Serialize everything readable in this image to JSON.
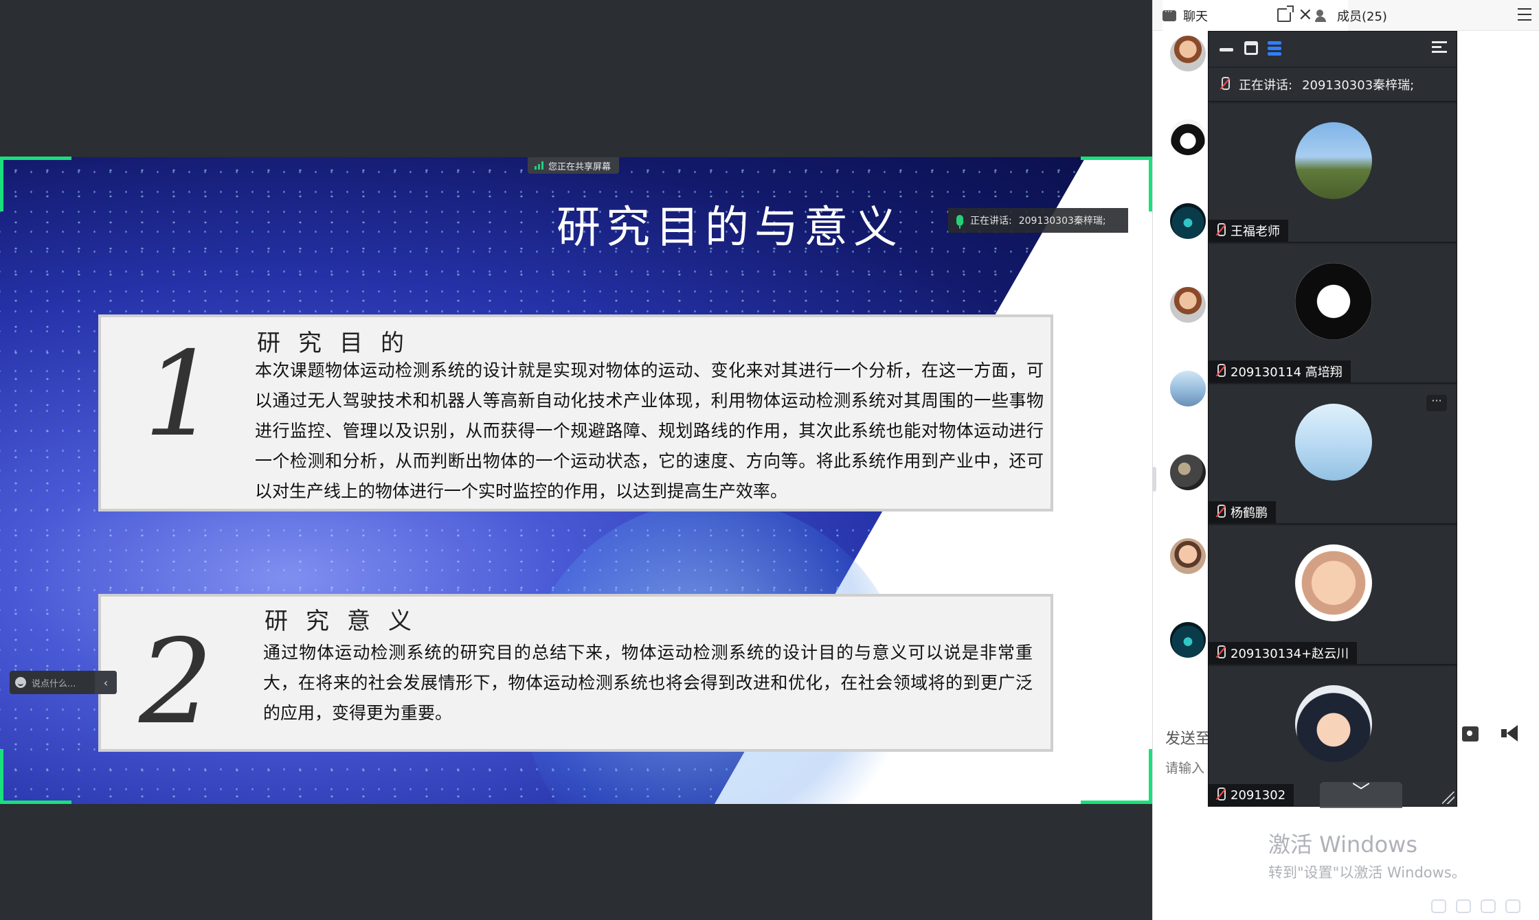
{
  "share": {
    "badge": "您正在共享屏幕",
    "speaking_label": "正在讲话:",
    "speaking_name": "209130303秦梓瑞;"
  },
  "slide": {
    "title": "研究目的与意义",
    "section1": {
      "number": "1",
      "heading": "研究目的",
      "body": "本次课题物体运动检测系统的设计就是实现对物体的运动、变化来对其进行一个分析，在这一方面，可以通过无人驾驶技术和机器人等高新自动化技术产业体现，利用物体运动检测系统对其周围的一些事物进行监控、管理以及识别，从而获得一个规避路障、规划路线的作用，其次此系统也能对物体运动进行一个检测和分析，从而判断出物体的一个运动状态，它的速度、方向等。将此系统作用到产业中，还可以对生产线上的物体进行一个实时监控的作用，以达到提高生产效率。"
    },
    "section2": {
      "number": "2",
      "heading": "研究意义",
      "body": "通过物体运动检测系统的研究目的总结下来，物体运动检测系统的设计目的与意义可以说是非常重大，在将来的社会发展情形下，物体运动检测系统也将会得到改进和优化，在社会领域将的到更广泛的应用，变得更为重要。"
    }
  },
  "chat_mini": {
    "placeholder": "说点什么..."
  },
  "panel": {
    "tab_chat": "聊天",
    "tab_members": "成员(25)",
    "send_to": "发送至",
    "input_placeholder": "请输入"
  },
  "video": {
    "speaking_label": "正在讲话:",
    "speaking_name": "209130303秦梓瑞;",
    "participants": [
      {
        "name": "王福老师",
        "avatar_icon": "horse-rider-avatar"
      },
      {
        "name": "209130114 高培翔",
        "avatar_icon": "anime-sketch-avatar"
      },
      {
        "name": "杨鹤鹏",
        "avatar_icon": "lake-scenery-avatar"
      },
      {
        "name": "209130134+赵云川",
        "avatar_icon": "baby-face-avatar"
      },
      {
        "name": "2091302",
        "avatar_icon": "anime-boy-avatar"
      }
    ],
    "more_label": "···",
    "scroll_label": "﹀"
  },
  "watermark": {
    "line1": "激活 Windows",
    "line2": "转到\"设置\"以激活 Windows。"
  },
  "colors": {
    "accent_green": "#19e07c",
    "accent_blue": "#2f7fff",
    "mic_muted_red": "#ff4a4a"
  }
}
